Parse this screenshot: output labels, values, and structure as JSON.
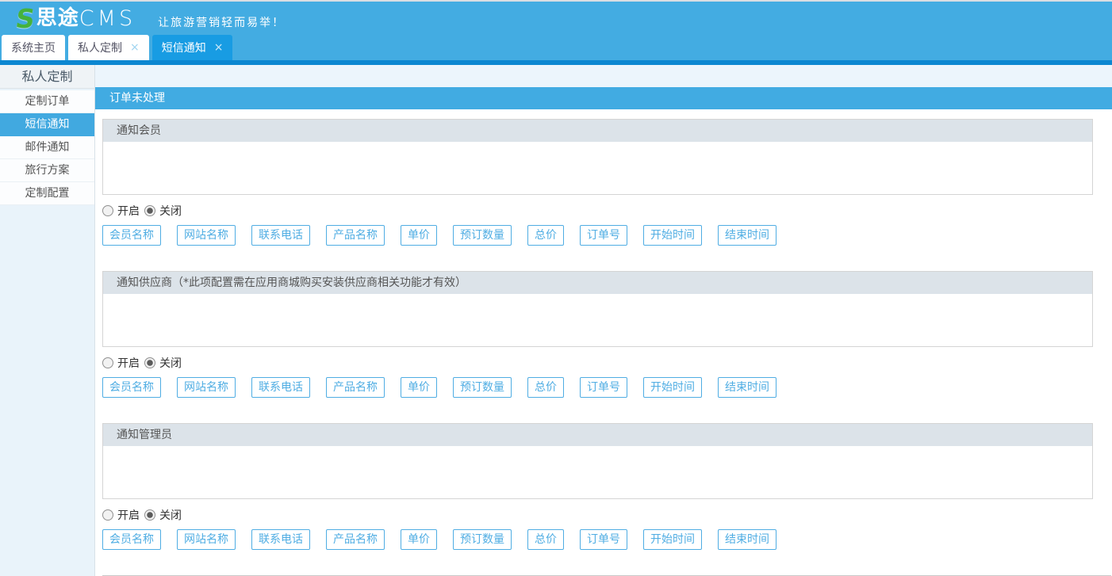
{
  "app": {
    "logo_s": "S",
    "logo_cn": "思途",
    "logo_cms": "CMS",
    "slogan": "让旅游营销轻而易举！"
  },
  "close_icon": "×",
  "tabs": [
    {
      "label": "系统主页",
      "closable": false,
      "active": false
    },
    {
      "label": "私人定制",
      "closable": true,
      "active": false
    },
    {
      "label": "短信通知",
      "closable": true,
      "active": true
    }
  ],
  "sidebar": {
    "title": "私人定制",
    "items": [
      {
        "label": "定制订单",
        "active": false
      },
      {
        "label": "短信通知",
        "active": true
      },
      {
        "label": "邮件通知",
        "active": false
      },
      {
        "label": "旅行方案",
        "active": false
      },
      {
        "label": "定制配置",
        "active": false
      }
    ]
  },
  "main": {
    "page_header": "订单未处理",
    "radio_on_label": "开启",
    "radio_off_label": "关闭",
    "tag_buttons": [
      "会员名称",
      "网站名称",
      "联系电话",
      "产品名称",
      "单价",
      "预订数量",
      "总价",
      "订单号",
      "开始时间",
      "结束时间"
    ],
    "sections": [
      {
        "title": "通知会员",
        "textarea_value": "",
        "selected": "off"
      },
      {
        "title": "通知供应商（*此项配置需在应用商城购买安装供应商相关功能才有效）",
        "textarea_value": "",
        "selected": "off"
      },
      {
        "title": "通知管理员",
        "textarea_value": "",
        "selected": "off"
      }
    ]
  },
  "colors": {
    "topbar": "#43ace2",
    "active_tab": "#189ce3",
    "dark_strip": "#0c87d1",
    "page_header_bar": "#41abe2",
    "sidebar_active": "#41a9e0",
    "section_header_bg": "#dce3e9",
    "tag_button": "#4fade3",
    "logo_green": "#45b23c"
  }
}
